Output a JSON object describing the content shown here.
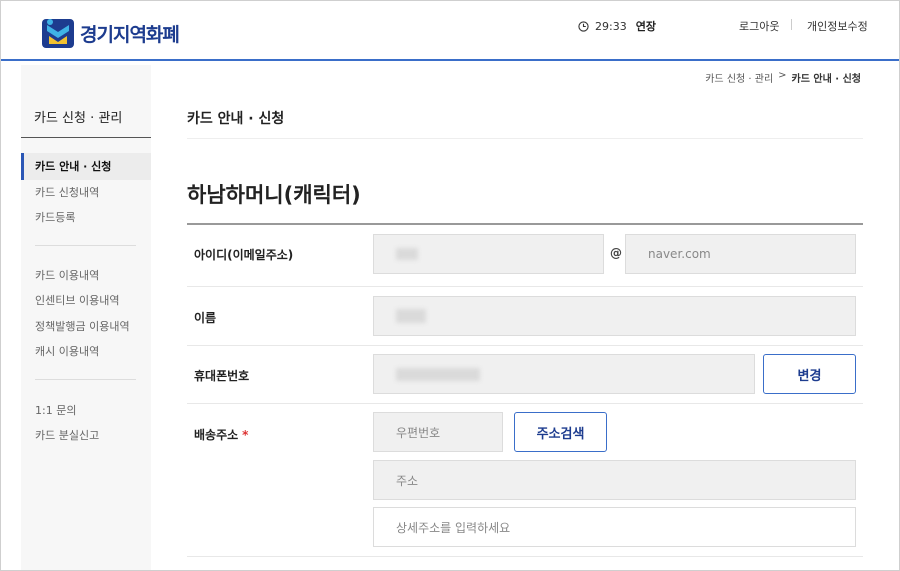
{
  "header": {
    "logo_text": "경기지역화폐",
    "timer": "29:33",
    "extend_label": "연장",
    "logout_label": "로그아웃",
    "profile_edit_label": "개인정보수정"
  },
  "breadcrumb": {
    "parent": "카드 신청 · 관리",
    "separator": ">",
    "current": "카드 안내 · 신청"
  },
  "sidebar": {
    "title": "카드 신청 · 관리",
    "group1": [
      "카드 안내 · 신청",
      "카드 신청내역",
      "카드등록"
    ],
    "group2": [
      "카드 이용내역",
      "인센티브 이용내역",
      "정책발행금 이용내역",
      "캐시 이용내역"
    ],
    "group3": [
      "1:1 문의",
      "카드 분실신고"
    ]
  },
  "main": {
    "section_title": "카드 안내 · 신청",
    "card_title": "하남하머니(캐릭터)"
  },
  "form": {
    "id_label": "아이디(이메일주소)",
    "at_sign": "@",
    "email_domain": "naver.com",
    "name_label": "이름",
    "phone_label": "휴대폰번호",
    "change_button": "변경",
    "address_label": "배송주소",
    "required_mark": "*",
    "zip_placeholder": "우편번호",
    "address_search_button": "주소검색",
    "address_placeholder": "주소",
    "detail_placeholder": "상세주소를 입력하세요"
  },
  "colors": {
    "accent": "#3a6ec9",
    "brand": "#1d3c8f",
    "required": "#d33333"
  }
}
